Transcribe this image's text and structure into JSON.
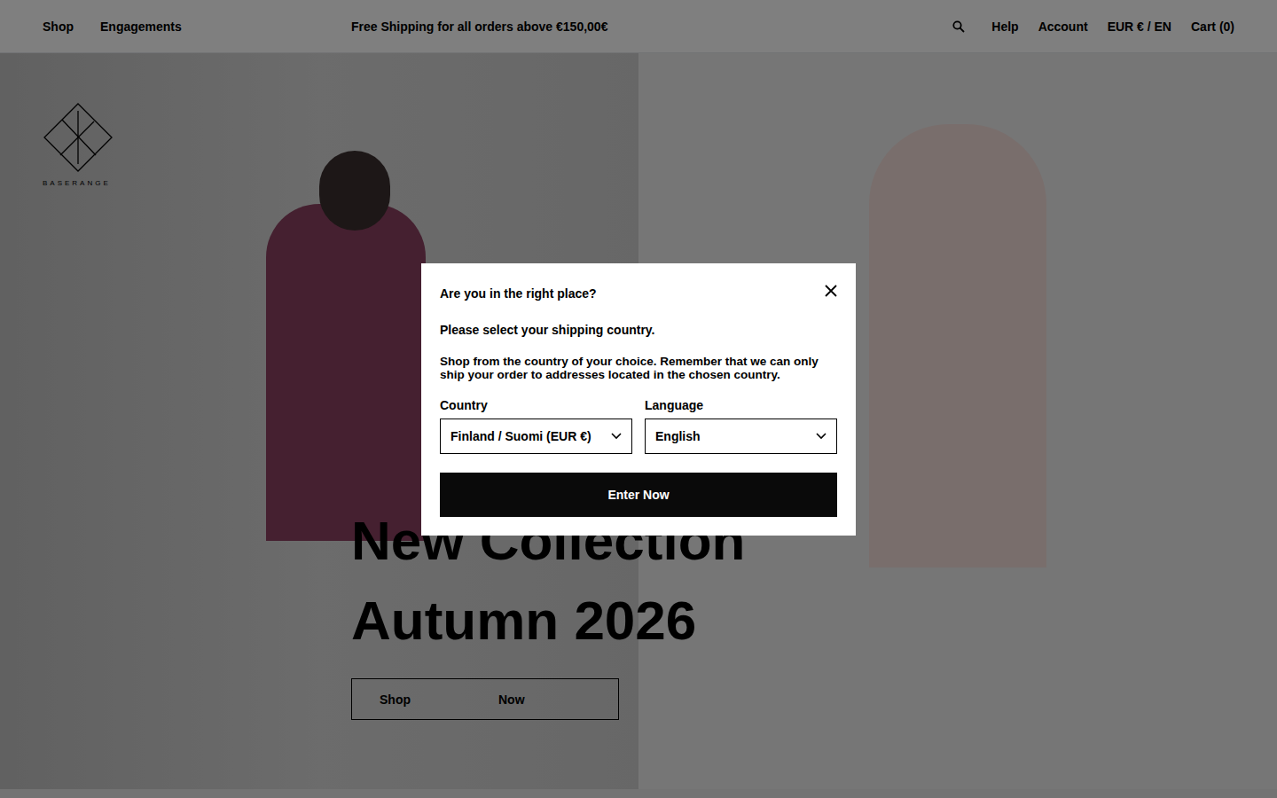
{
  "nav": {
    "left": [
      "Shop",
      "Engagements"
    ],
    "promo": "Free Shipping for all orders above €150,00€",
    "right": [
      "Help",
      "Account",
      "EUR € / EN",
      "Cart (0)"
    ]
  },
  "logo": {
    "wordmark": "BASERANGE"
  },
  "hero": {
    "title_lines": [
      "New Collection",
      "Autumn 2026"
    ],
    "button": [
      "Shop",
      "Now"
    ]
  },
  "modal": {
    "title": "Are you in the right place?",
    "subtitle": "Please select your shipping country.",
    "body": "Shop from the country of your choice. Remember that we can only ship your order to addresses located in the chosen country.",
    "fields": [
      {
        "label": "Country",
        "value": "Finland / Suomi (EUR €)"
      },
      {
        "label": "Language",
        "value": "English"
      }
    ],
    "submit": "Enter Now"
  }
}
